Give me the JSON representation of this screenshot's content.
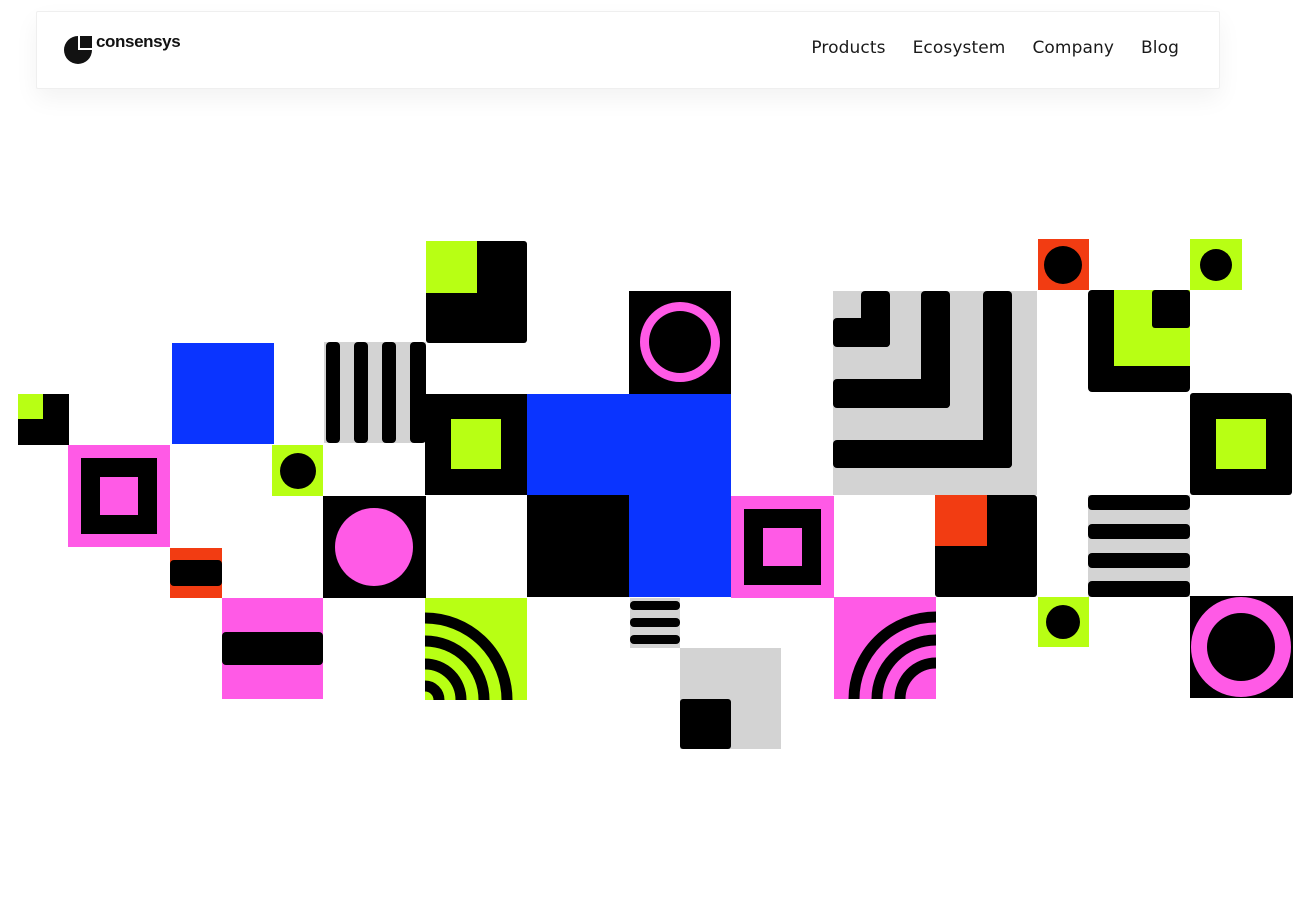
{
  "brand": {
    "name": "consensys",
    "logo_icon": "consensys-logo-icon"
  },
  "nav": {
    "items": [
      {
        "label": "Products"
      },
      {
        "label": "Ecosystem"
      },
      {
        "label": "Company"
      },
      {
        "label": "Blog"
      }
    ]
  },
  "hero": {
    "graphic": "geometric-tile-mosaic"
  },
  "colors": {
    "black": "#000000",
    "blue": "#0a34ff",
    "pink": "#ff5ae6",
    "lime": "#b8ff14",
    "red": "#f23c12",
    "gray": "#d3d3d3",
    "white": "#ffffff"
  }
}
